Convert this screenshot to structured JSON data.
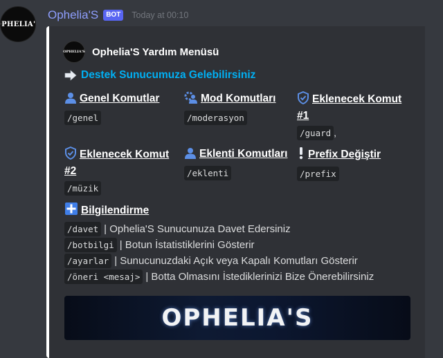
{
  "message": {
    "avatar_text": "OPHELIA'S",
    "username": "Ophelia'S",
    "bot_tag": "BOT",
    "timestamp": "Today at 00:10"
  },
  "embed": {
    "border_color": "#ffffff",
    "author_icon_text": "OPHELIA'S",
    "author_name": "Ophelia'S Yardım Menüsü",
    "title": "Destek Sunucumuza Gelebilirsiniz",
    "fields": [
      {
        "icon": "user-icon",
        "name": "Genel Komutlar",
        "value": "/genel",
        "suffix": ""
      },
      {
        "icon": "gear-user-icon",
        "name": "Mod Komutları",
        "value": "/moderasyon",
        "suffix": ""
      },
      {
        "icon": "shield-check-icon",
        "name": "Eklenecek Komut #1",
        "value": "/guard",
        "suffix": ","
      },
      {
        "icon": "shield-check-icon",
        "name": "Eklenecek Komut #2",
        "value": "/müzik",
        "suffix": ""
      },
      {
        "icon": "user-icon",
        "name": "Eklenti Komutları",
        "value": "/eklenti",
        "suffix": ""
      },
      {
        "icon": "exclamation-icon",
        "name": "Prefix Değiştir",
        "value": "/prefix",
        "suffix": ""
      }
    ],
    "info": {
      "icon": "plus-square-icon",
      "name": "Bilgilendirme",
      "rows": [
        {
          "cmd": "/davet",
          "text": "| Ophelia'S Sunucunuza Davet Edersiniz"
        },
        {
          "cmd": "/botbilgi",
          "text": "| Botun İstatistiklerini Gösterir"
        },
        {
          "cmd": "/ayarlar",
          "text": "| Sunucunuzdaki Açık veya Kapalı Komutları Gösterir"
        },
        {
          "cmd": "/öneri <mesaj>",
          "text": "| Botta Olmasını İstediklerinizi Bize Önerebilirsiniz"
        }
      ]
    },
    "banner_text": "OPHELIA'S"
  }
}
